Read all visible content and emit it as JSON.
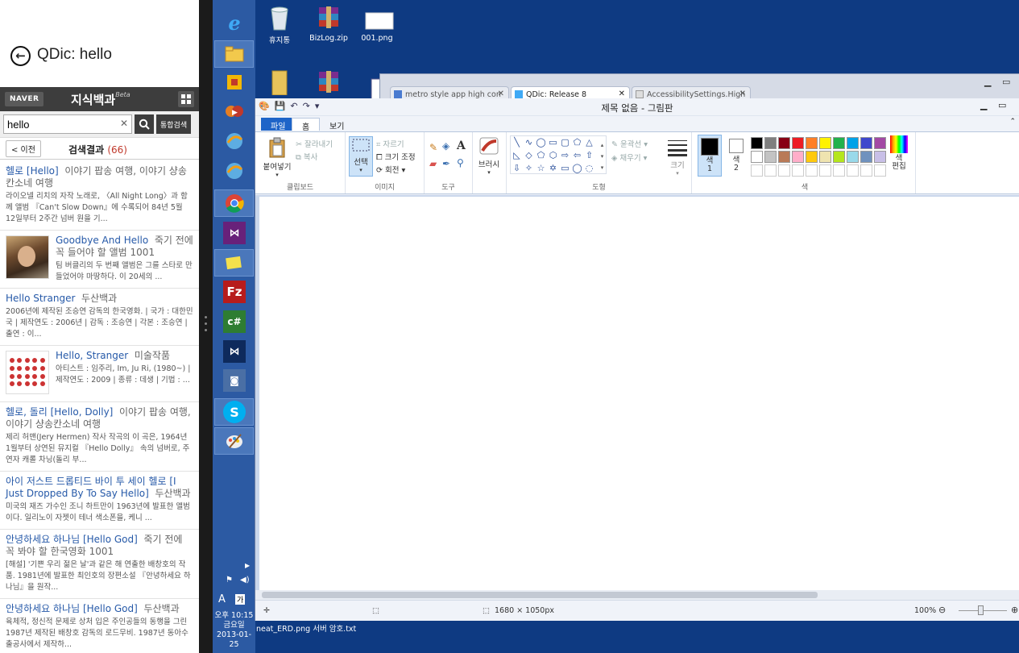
{
  "qdic": {
    "title": "QDic: hello",
    "naver_logo": "NAVER",
    "naver_title": "지식백과",
    "naver_beta": "Beta",
    "search": {
      "value": "hello",
      "clear": "✕",
      "all_search": "통합검색"
    },
    "prev": "< 이전",
    "result_label": "검색결과",
    "result_count": "(66)",
    "results": [
      {
        "t1": "헬로 [Hello]",
        "t2": "이야기 팝송 여행, 이야기 샹송칸소네 여행",
        "desc": "라이오넬 리치의 자작 노래로, 〈All Night Long〉과 함께 앨범 『Can't Slow Down』에 수록되어 84년 5월 12일부터 2주간 넘버 원을 기..."
      },
      {
        "t1": "Goodbye And Hello",
        "t2": "죽기 전에 꼭 들어야 할 앨범 1001",
        "desc": "팀 버클리의 두 번째 앨범은 그를 스타로 만들었어야 마땅하다. 이 20세의 ..."
      },
      {
        "t1": "Hello Stranger",
        "t2": "두산백과",
        "desc": "2006년에 제작된 조승연 감독의 한국영화. | 국가 : 대한민국 | 제작연도 : 2006년 | 감독 : 조승연 | 각본 : 조승연 | 출연 : 이..."
      },
      {
        "t1": "Hello, Stranger",
        "t2": "미술작품",
        "desc": "아티스트 : 임주리, Im, Ju Ri, (1980~) | 제작연도 : 2009 | 종류 : 데생 | 기법 : ..."
      },
      {
        "t1": "헬로, 돌리 [Hello, Dolly]",
        "t2": "이야기 팝송 여행, 이야기 샹송칸소네 여행",
        "desc": "제리 허맨(Jery Hermen) 작사 작곡의 이 곡은, 1964년 1월부터 상연된 뮤지컬 『Hello Dolly』 속의 넘버로, 주연자 캐롤 차닝(돌리 부..."
      },
      {
        "t1": "아이 저스트 드롭티드 바이 투 세이 헬로 [I Just Dropped By To Say Hello]",
        "t2": "두산백과",
        "desc": "미국의 재즈 가수인 조니 하트만이 1963년에 발표한 앨범이다. 일리노이 자젯이 테너 색소폰을, 케니 ..."
      },
      {
        "t1": "안녕하세요 하나님 [Hello God]",
        "t2": "죽기 전에 꼭 봐야 할 한국영화 1001",
        "desc": "[해설] '기쁜 우리 젊은 날'과 같은 해 연출한 배창호의 작품. 1981년에 발표한 최인호의 장편소설 『안녕하세요 하나님』을 원작..."
      },
      {
        "t1": "안녕하세요 하나님 [Hello God]",
        "t2": "두산백과",
        "desc": "육체적, 정신적 문제로 상처 입은 주인공들의 동행을 그린 1987년 제작된 배창호 감독의 로드무비. 1987년 동아수출공사에서 제작하..."
      }
    ]
  },
  "desktop": {
    "icons": [
      {
        "label": "휴지통",
        "icon": "recycle-bin-icon"
      },
      {
        "label": "BizLog.zip",
        "icon": "winrar-archive-icon"
      },
      {
        "label": "001.png",
        "icon": "png-file-icon"
      }
    ],
    "bottom_files": "neat_ERD.png  서버 암호.txt",
    "clock": {
      "time": "오후 10:15",
      "day": "금요일",
      "date": "2013-01-25"
    },
    "tray_a": "A",
    "tray_han": "가"
  },
  "browser": {
    "tabs": [
      {
        "label": "metro style app high con"
      },
      {
        "label": "QDic: Release 8"
      },
      {
        "label": "AccessibilitySettings.High"
      }
    ]
  },
  "paint": {
    "title": "제목 없음 - 그림판",
    "tabs": {
      "file": "파일",
      "home": "홈",
      "view": "보기"
    },
    "clipboard": {
      "paste": "붙여넣기",
      "cut": "잘라내기",
      "copy": "복사",
      "label": "클립보드"
    },
    "image": {
      "select": "선택",
      "crop": "자르기",
      "resize": "크기 조정",
      "rotate": "회전",
      "label": "이미지"
    },
    "tools": {
      "label": "도구"
    },
    "brushes": {
      "label": "브러시"
    },
    "shapes": {
      "outline": "윤곽선",
      "fill": "채우기",
      "label": "도형"
    },
    "size": {
      "label": "크기"
    },
    "colors": {
      "color1": "색\n1",
      "color2": "색\n2",
      "edit": "색\n편집",
      "label": "색"
    },
    "palette": [
      "#000000",
      "#7f7f7f",
      "#880015",
      "#ed1c24",
      "#ff7f27",
      "#fff200",
      "#22b14c",
      "#00a2e8",
      "#3f48cc",
      "#a349a4",
      "#ffffff",
      "#c3c3c3",
      "#b97a57",
      "#ffaec9",
      "#ffc90e",
      "#efe4b0",
      "#b5e61d",
      "#99d9ea",
      "#7092be",
      "#c8bfe7"
    ],
    "status": {
      "dimensions": "1680 × 1050px",
      "zoom": "100%"
    }
  }
}
